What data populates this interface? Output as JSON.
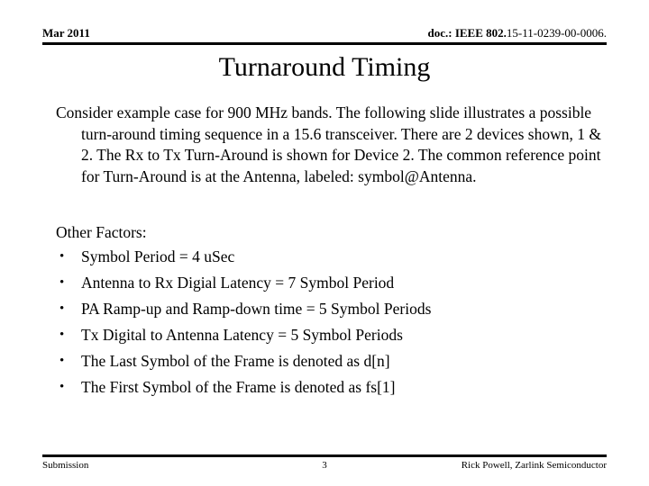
{
  "header": {
    "date": "Mar 2011",
    "doc_prefix": "doc.: IEEE 802.",
    "doc_suffix": "15-11-0239-00-0006."
  },
  "title": "Turnaround Timing",
  "body": {
    "paragraph": "Consider example case for 900 MHz bands.  The following slide illustrates a possible turn-around timing sequence in a 15.6 transceiver.  There are 2 devices shown, 1 & 2.  The Rx to Tx Turn-Around is shown for Device 2.  The common reference point for Turn-Around is at the Antenna, labeled: symbol@Antenna.",
    "other_factors_label": "Other Factors:",
    "bullet_marker": "•",
    "bullets": [
      "Symbol Period = 4 uSec",
      "Antenna to Rx Digial Latency = 7 Symbol Period",
      "PA Ramp-up and Ramp-down time = 5 Symbol Periods",
      "Tx Digital to Antenna Latency = 5 Symbol Periods",
      "The Last Symbol of the Frame is denoted as d[n]",
      "The First Symbol of the Frame is denoted as fs[1]"
    ]
  },
  "footer": {
    "left": "Submission",
    "page_number": "3",
    "right": "Rick Powell, Zarlink Semiconductor"
  }
}
